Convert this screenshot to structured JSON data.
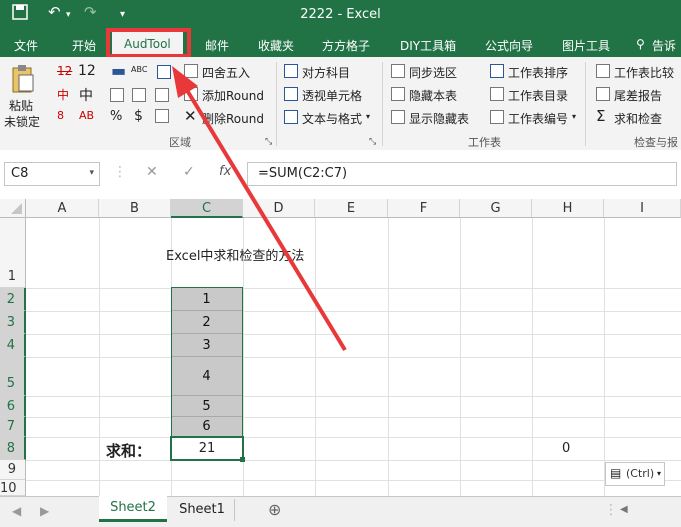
{
  "title_bar": {
    "file_title": "2222 - Excel"
  },
  "tabs": [
    "文件",
    "开始",
    "AudTool",
    "邮件",
    "收藏夹",
    "方方格子",
    "DIY工具箱",
    "公式向导",
    "图片工具",
    "告诉"
  ],
  "active_tab": "AudTool",
  "ribbon": {
    "paste_top": "粘贴",
    "paste_bottom": "未锁定",
    "num_12": "12",
    "zhong": "中",
    "round_label": "四舍五入",
    "add_round": "添加Round",
    "del_round": "删除Round",
    "percent": "%",
    "dollar": "$",
    "group_area": "区域",
    "duifang": "对方科目",
    "toushi": "透视单元格",
    "wenben": "文本与格式",
    "tongbu": "同步选区",
    "yincang": "隐藏本表",
    "xianshi": "显示隐藏表",
    "paixu": "工作表排序",
    "mulu": "工作表目录",
    "bianhao": "工作表编号",
    "group_sheet": "工作表",
    "bijiao": "工作表比较",
    "weicha": "尾差报告",
    "qiuhe": "求和检查",
    "group_check": "检查与报"
  },
  "formula_bar": {
    "name_box": "C8",
    "fx": "fx",
    "formula": "=SUM(C2:C7)"
  },
  "columns": [
    "A",
    "B",
    "C",
    "D",
    "E",
    "F",
    "G",
    "H",
    "I"
  ],
  "rows": [
    "1",
    "2",
    "3",
    "4",
    "5",
    "6",
    "7",
    "8",
    "9",
    "10"
  ],
  "cells": {
    "heading": "Excel中求和检查的方法",
    "values": [
      "1",
      "2",
      "3",
      "4",
      "5",
      "6"
    ],
    "sum_label": "求和：",
    "sum_value": "21",
    "h8": "0"
  },
  "paste_options": "(Ctrl)",
  "sheets": [
    "Sheet2",
    "Sheet1"
  ],
  "active_sheet": "Sheet2",
  "colors": {
    "excel_green": "#217346",
    "highlight_red": "#e8383a"
  }
}
